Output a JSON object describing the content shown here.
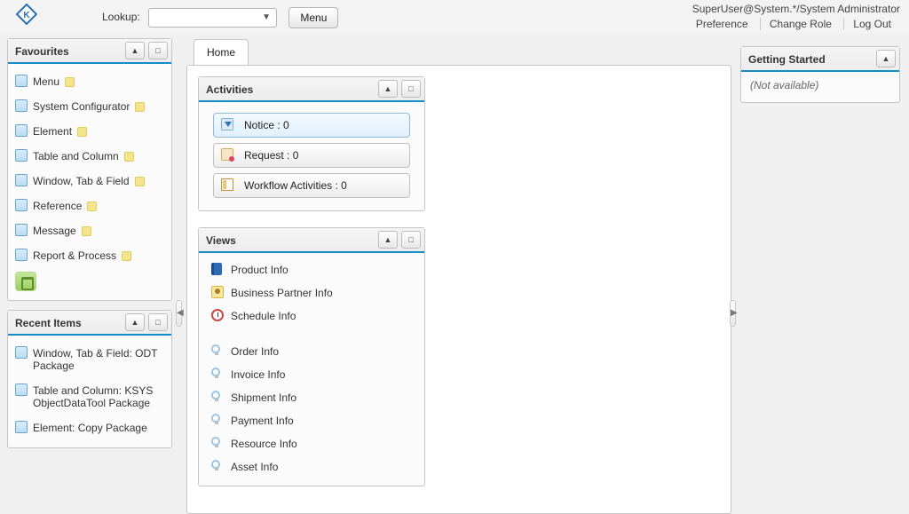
{
  "topbar": {
    "lookup_label": "Lookup:",
    "menu_button": "Menu",
    "user_display": "SuperUser@System.*/System Administrator",
    "links": {
      "preference": "Preference",
      "change_role": "Change Role",
      "logout": "Log Out"
    }
  },
  "favourites": {
    "title": "Favourites",
    "items": [
      "Menu",
      "System Configurator",
      "Element",
      "Table and Column",
      "Window, Tab & Field",
      "Reference",
      "Message",
      "Report & Process"
    ]
  },
  "recent": {
    "title": "Recent Items",
    "items": [
      "Window, Tab & Field: ODT Package",
      "Table and Column: KSYS ObjectDataTool Package",
      "Element: Copy Package"
    ]
  },
  "home_tab": "Home",
  "activities": {
    "title": "Activities",
    "buttons": {
      "notice": "Notice : 0",
      "request": "Request : 0",
      "workflow": "Workflow Activities : 0"
    }
  },
  "views": {
    "title": "Views",
    "top_items": [
      "Product Info",
      "Business Partner Info",
      "Schedule Info"
    ],
    "bottom_items": [
      "Order Info",
      "Invoice Info",
      "Shipment Info",
      "Payment Info",
      "Resource Info",
      "Asset Info"
    ]
  },
  "getting_started": {
    "title": "Getting Started",
    "content": "(Not available)"
  }
}
